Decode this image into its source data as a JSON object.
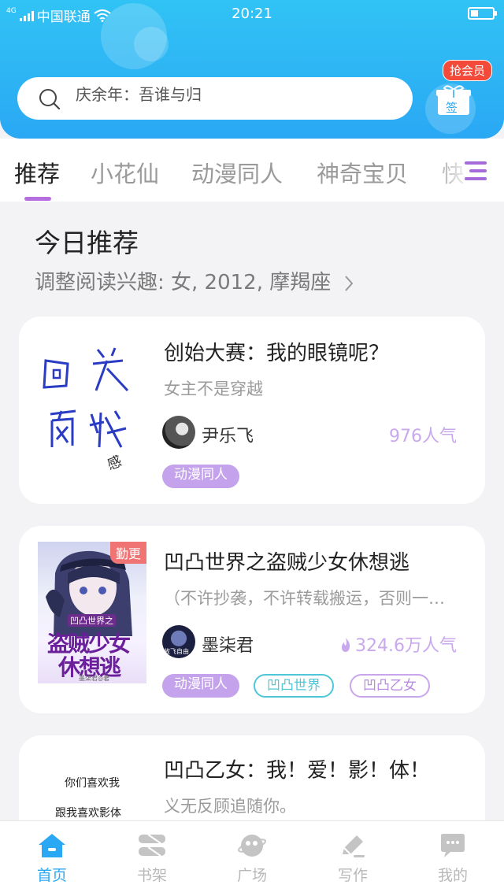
{
  "status": {
    "network": "4G",
    "carrier": "中国联通",
    "time": "20:21"
  },
  "search": {
    "placeholder": "庆余年：吾谁与归"
  },
  "sign_in": {
    "vip_badge": "抢会员",
    "label": "签"
  },
  "tabs": [
    {
      "label": "推荐",
      "active": true
    },
    {
      "label": "小花仙",
      "active": false
    },
    {
      "label": "动漫同人",
      "active": false
    },
    {
      "label": "神奇宝贝",
      "active": false
    },
    {
      "label": "快",
      "active": false
    }
  ],
  "section": {
    "title": "今日推荐",
    "subtitle": "调整阅读兴趣: 女, 2012, 摩羯座",
    "chevron_icon": "chevron-right-icon"
  },
  "books": [
    {
      "title": "创始大赛：我的眼镜呢？",
      "desc": "女主不是穿越",
      "author": "尹乐飞",
      "popularity": "976人气",
      "cover_text": [
        "回 关",
        "再 找"
      ],
      "cover_signature": "感",
      "tags": [
        {
          "label": "动漫同人",
          "style": "purple"
        }
      ]
    },
    {
      "title": "凹凸世界之盗贼少女休想逃",
      "desc": "（不许抄袭，不许转载搬运，否则一…",
      "author": "墨柒君",
      "popularity": "324.6万人气",
      "badge": "勤更",
      "cover_series": "凹凸世界之",
      "cover_title_1": "盗贼少女",
      "cover_title_2": "休想逃",
      "cover_author": "墨柒君◎著",
      "avatar_text": "故飞自由",
      "tags": [
        {
          "label": "动漫同人",
          "style": "purple"
        },
        {
          "label": "凹凸世界",
          "style": "teal"
        },
        {
          "label": "凹凸乙女",
          "style": "lav"
        }
      ]
    },
    {
      "title": "凹凸乙女：我！爱！影！体！",
      "desc": "义无反顾追随你。",
      "cover_lines": [
        "你们喜欢我",
        "跟我喜欢影体"
      ]
    }
  ],
  "nav": [
    {
      "label": "首页",
      "icon": "home-icon",
      "active": true
    },
    {
      "label": "书架",
      "icon": "bookshelf-icon",
      "active": false
    },
    {
      "label": "广场",
      "icon": "planet-icon",
      "active": false
    },
    {
      "label": "写作",
      "icon": "pencil-icon",
      "active": false
    },
    {
      "label": "我的",
      "icon": "chat-bubble-icon",
      "active": false
    }
  ],
  "colors": {
    "header": "#2aa8f4",
    "accent": "#b46ee0",
    "vip_badge": "#f34a3a",
    "tag_purple": "#c4a3ec",
    "tag_teal": "#4fc7d8"
  }
}
